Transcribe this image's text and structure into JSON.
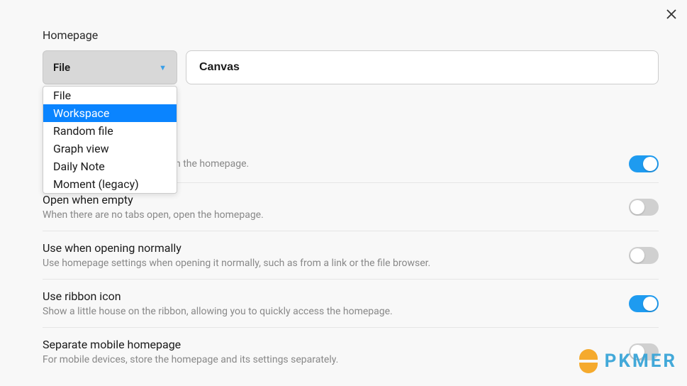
{
  "section_label": "Homepage",
  "dropdown": {
    "selected": "File",
    "options": [
      "File",
      "Workspace",
      "Random file",
      "Graph view",
      "Daily Note",
      "Moment (legacy)"
    ],
    "highlighted_index": 1
  },
  "input_value": "Canvas",
  "partial_text": "When launching Obsidian, open the homepage.",
  "settings": [
    {
      "title": "",
      "desc": "When launching Obsidian, open the homepage.",
      "on": true
    },
    {
      "title": "Open when empty",
      "desc": "When there are no tabs open, open the homepage.",
      "on": false
    },
    {
      "title": "Use when opening normally",
      "desc": "Use homepage settings when opening it normally, such as from a link or the file browser.",
      "on": false
    },
    {
      "title": "Use ribbon icon",
      "desc": "Show a little house on the ribbon, allowing you to quickly access the homepage.",
      "on": true
    },
    {
      "title": "Separate mobile homepage",
      "desc": "For mobile devices, store the homepage and its settings separately.",
      "on": false
    }
  ],
  "watermark": "PKMER"
}
